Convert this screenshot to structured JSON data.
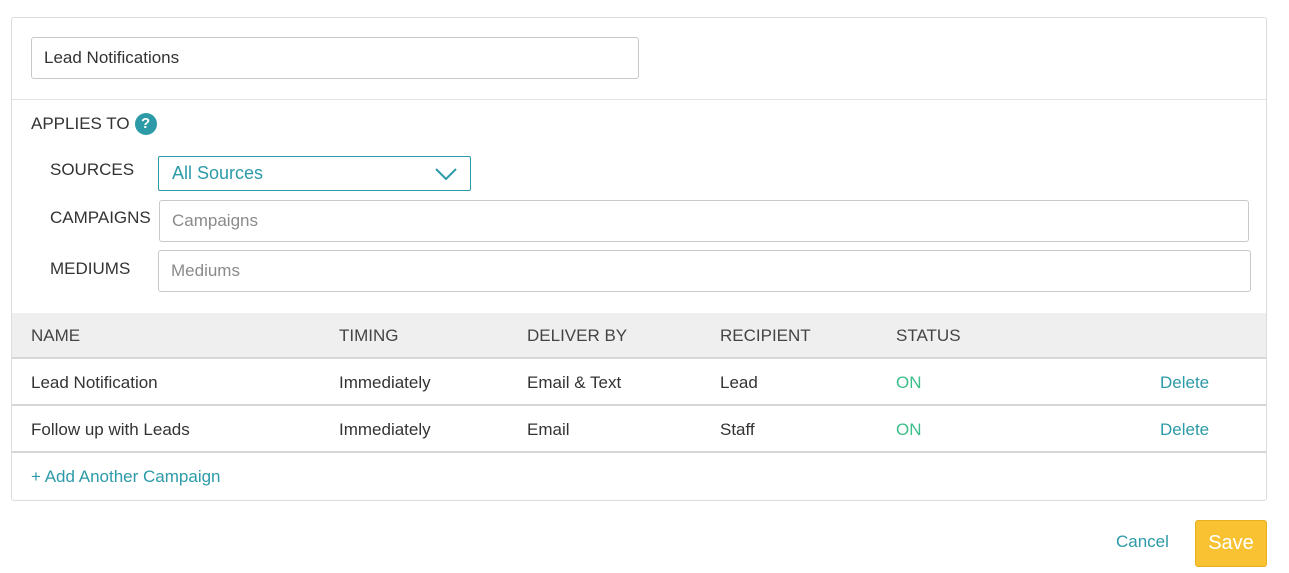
{
  "notification_name": {
    "value": "Lead Notifications"
  },
  "applies_to": {
    "title": "APPLIES TO",
    "help_icon": "question-circle-icon",
    "sources": {
      "label": "SOURCES",
      "selected": "All Sources"
    },
    "campaigns": {
      "label": "CAMPAIGNS",
      "placeholder": "Campaigns"
    },
    "mediums": {
      "label": "MEDIUMS",
      "placeholder": "Mediums"
    }
  },
  "table": {
    "headers": [
      "NAME",
      "TIMING",
      "DELIVER BY",
      "RECIPIENT",
      "STATUS"
    ],
    "rows": [
      {
        "name": "Lead Notification",
        "timing": "Immediately",
        "deliver_by": "Email & Text",
        "recipient": "Lead",
        "status": "ON",
        "action": "Delete"
      },
      {
        "name": "Follow up with Leads",
        "timing": "Immediately",
        "deliver_by": "Email",
        "recipient": "Staff",
        "status": "ON",
        "action": "Delete"
      }
    ]
  },
  "add_campaign_label": "+ Add Another Campaign",
  "footer": {
    "cancel_label": "Cancel",
    "save_label": "Save"
  },
  "colors": {
    "accent": "#2d9aa8",
    "status_on": "#3cbf8b",
    "save": "#f8c232"
  }
}
